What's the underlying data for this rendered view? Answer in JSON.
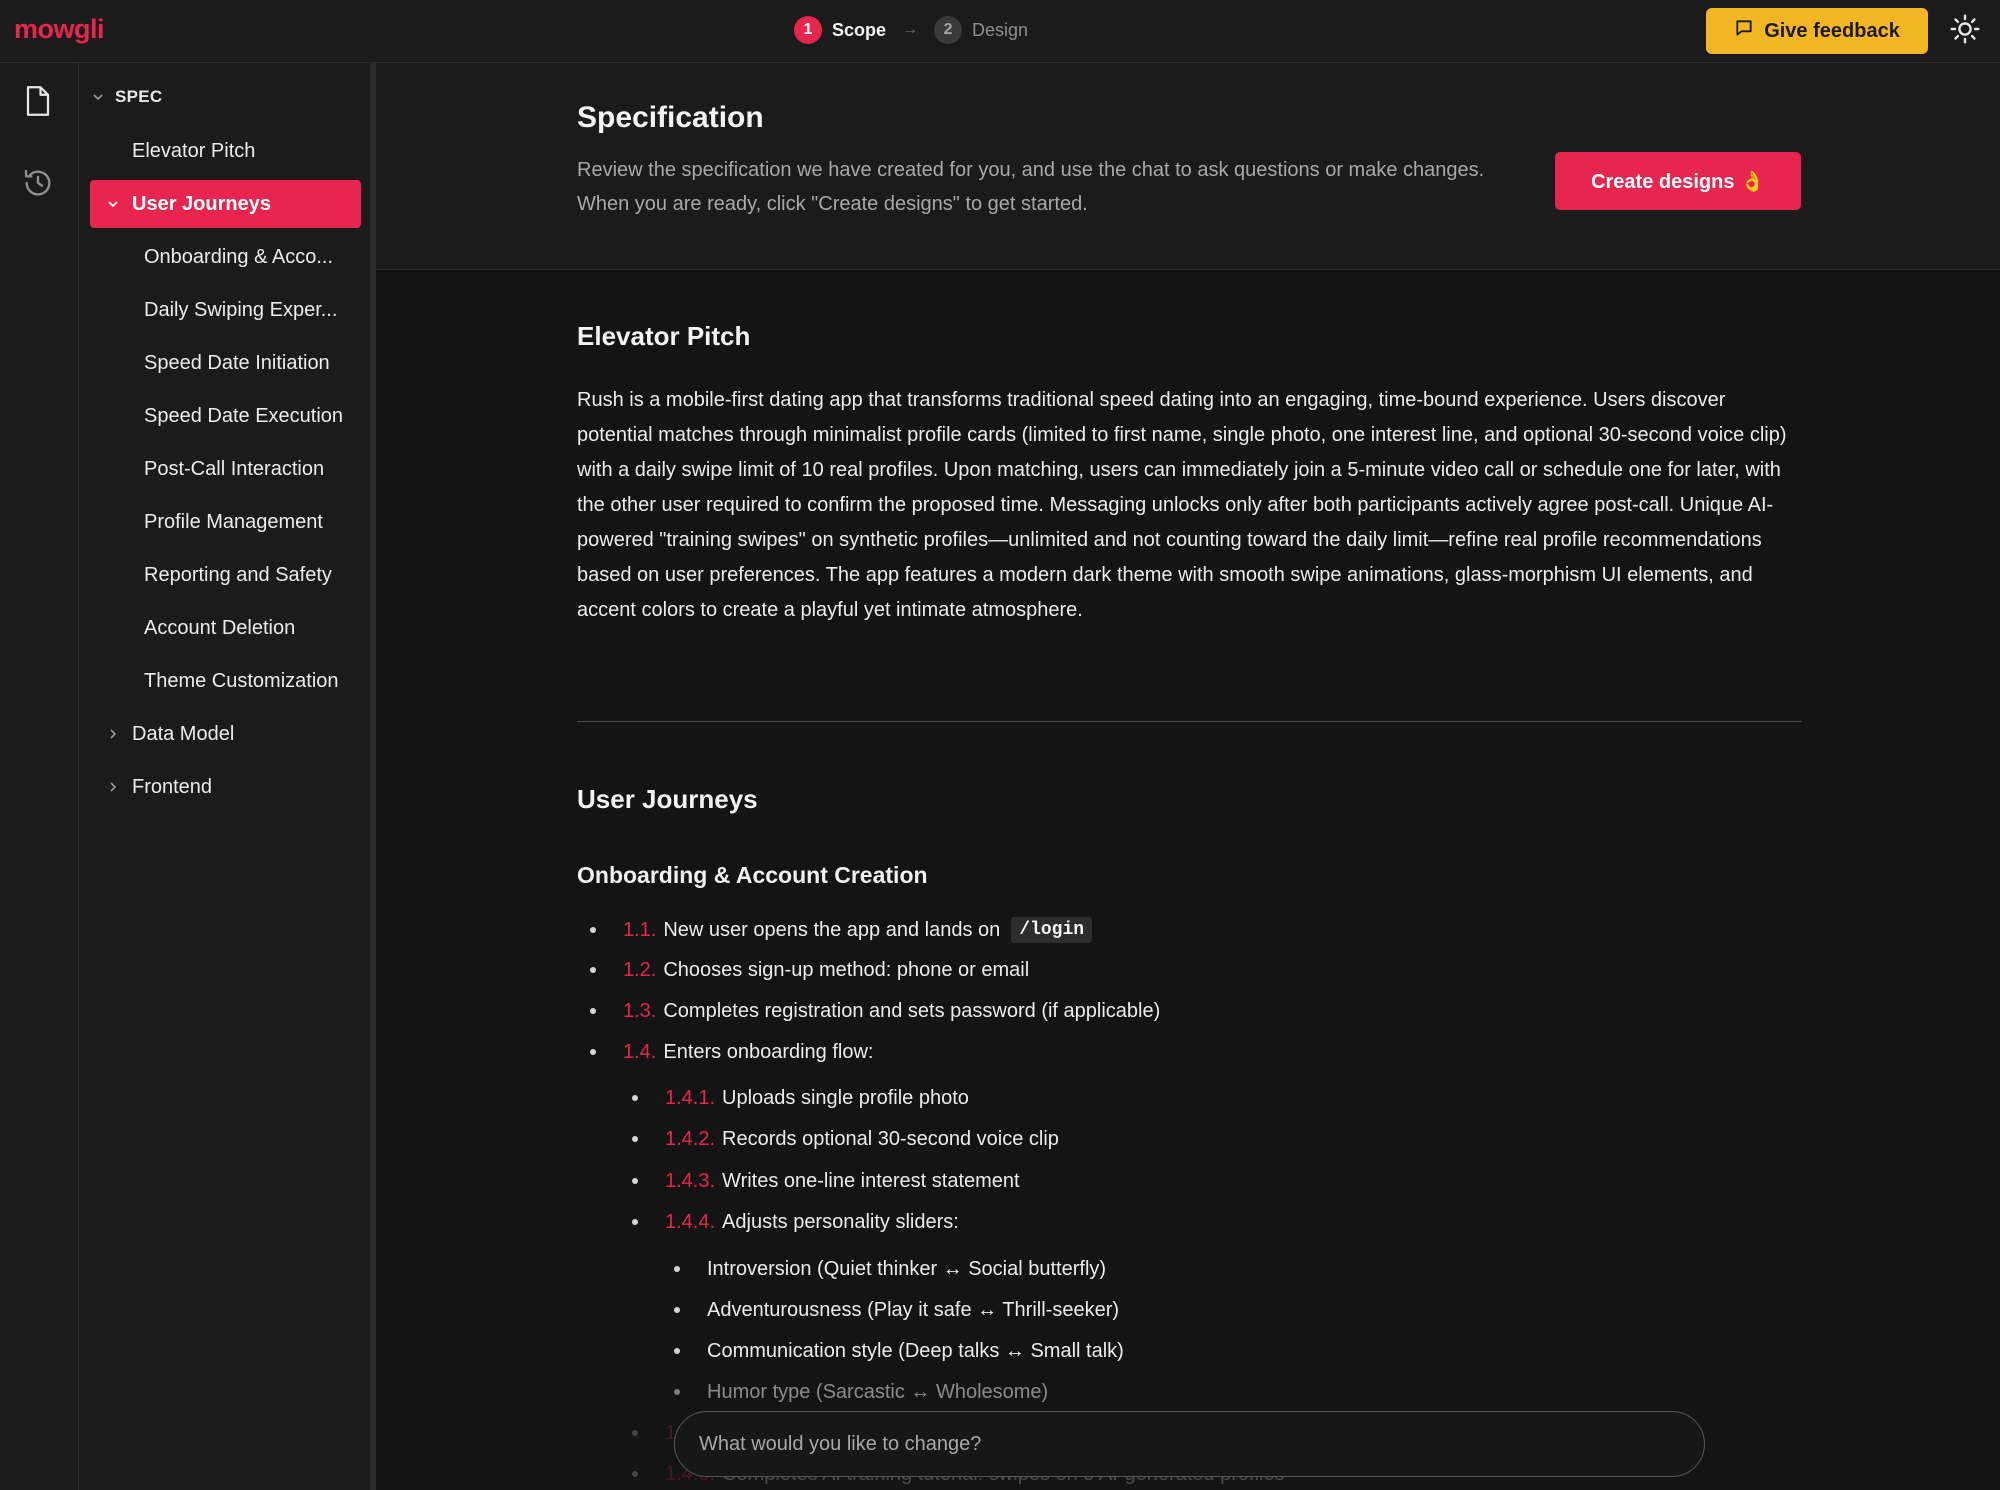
{
  "app": {
    "logo": "mowgli",
    "steps": [
      {
        "num": "1",
        "label": "Scope"
      },
      {
        "num": "2",
        "label": "Design"
      }
    ],
    "step_arrow": "→",
    "feedback_label": "Give feedback"
  },
  "sidebar": {
    "section_title": "SPEC",
    "items": [
      {
        "label": "Elevator Pitch"
      },
      {
        "label": "User Journeys"
      },
      {
        "label": "Onboarding & Acco..."
      },
      {
        "label": "Daily Swiping Exper..."
      },
      {
        "label": "Speed Date Initiation"
      },
      {
        "label": "Speed Date Execution"
      },
      {
        "label": "Post-Call Interaction"
      },
      {
        "label": "Profile Management"
      },
      {
        "label": "Reporting and Safety"
      },
      {
        "label": "Account Deletion"
      },
      {
        "label": "Theme Customization"
      },
      {
        "label": "Data Model"
      },
      {
        "label": "Frontend"
      }
    ]
  },
  "header": {
    "title": "Specification",
    "description": "Review the specification we have created for you, and use the chat to ask questions or make changes. When you are ready, click \"Create designs\" to get started.",
    "create_label": "Create designs 👌"
  },
  "content": {
    "elevator_title": "Elevator Pitch",
    "elevator_text": "Rush is a mobile-first dating app that transforms traditional speed dating into an engaging, time-bound experience. Users discover potential matches through minimalist profile cards (limited to first name, single photo, one interest line, and optional 30-second voice clip) with a daily swipe limit of 10 real profiles. Upon matching, users can immediately join a 5-minute video call or schedule one for later, with the other user required to confirm the proposed time. Messaging unlocks only after both participants actively agree post-call. Unique AI-powered \"training swipes\" on synthetic profiles—unlimited and not counting toward the daily limit—refine real profile recommendations based on user preferences. The app features a modern dark theme with smooth swipe animations, glass-morphism UI elements, and accent colors to create a playful yet intimate atmosphere.",
    "journeys_title": "User Journeys",
    "onboarding_title": "Onboarding & Account Creation",
    "steps": [
      {
        "num": "1.1.",
        "text": "New user opens the app and lands on",
        "code": "/login"
      },
      {
        "num": "1.2.",
        "text": "Chooses sign-up method: phone or email"
      },
      {
        "num": "1.3.",
        "text": "Completes registration and sets password (if applicable)"
      },
      {
        "num": "1.4.",
        "text": "Enters onboarding flow:"
      },
      {
        "num": "1.4.1.",
        "text": "Uploads single profile photo"
      },
      {
        "num": "1.4.2.",
        "text": "Records optional 30-second voice clip"
      },
      {
        "num": "1.4.3.",
        "text": "Writes one-line interest statement"
      },
      {
        "num": "1.4.4.",
        "text": "Adjusts personality sliders:"
      },
      {
        "num": "1.4.6.",
        "text": "Completes AI training tutorial: swipes on 5 AI-generated profiles"
      }
    ],
    "sliders": [
      "Introversion (Quiet thinker ↔ Social butterfly)",
      "Adventurousness (Play it safe ↔ Thrill-seeker)",
      "Communication style (Deep talks ↔ Small talk)",
      "Humor type (Sarcastic ↔ Wholesome)"
    ],
    "partial_num": "1."
  },
  "chat": {
    "placeholder": "What would you like to change?"
  },
  "colors": {
    "accent": "#e8254e",
    "feedback": "#f5b625",
    "background": "#141414",
    "panel": "#1b1b1b"
  },
  "icons": [
    "document-icon",
    "history-icon",
    "sun-icon",
    "chat-bubble-icon",
    "chevron-down-icon",
    "chevron-right-icon",
    "arrow-right-icon"
  ]
}
